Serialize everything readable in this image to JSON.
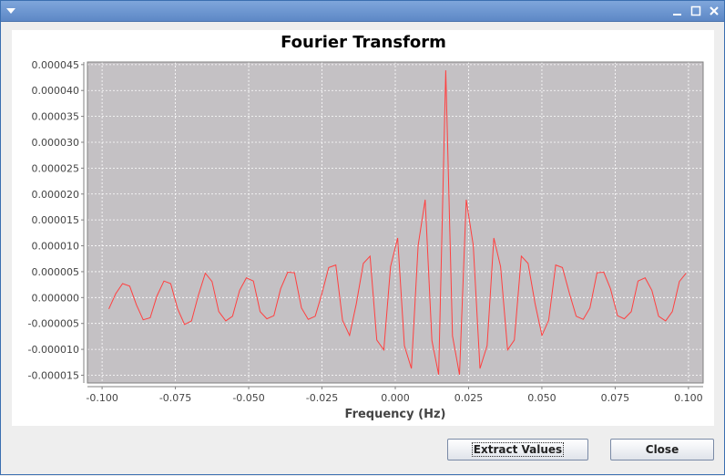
{
  "window": {
    "title": "",
    "icons": [
      "window-menu-icon",
      "minimize-icon",
      "maximize-icon",
      "close-icon"
    ]
  },
  "chart_data": {
    "type": "line",
    "title": "Fourier Transform",
    "xlabel": "Frequency (Hz)",
    "ylabel": "",
    "xlim": [
      -0.105,
      0.105
    ],
    "ylim": [
      -1.65e-05,
      4.55e-05
    ],
    "grid": true,
    "x_ticks": [
      -0.1,
      -0.075,
      -0.05,
      -0.025,
      0.0,
      0.025,
      0.05,
      0.075,
      0.1
    ],
    "x_tick_labels": [
      "-0.100",
      "-0.075",
      "-0.050",
      "-0.025",
      "0.000",
      "0.025",
      "0.050",
      "0.075",
      "0.100"
    ],
    "y_ticks": [
      -1.5e-05,
      -1e-05,
      -5e-06,
      0.0,
      5e-06,
      1e-05,
      1.5e-05,
      2e-05,
      2.5e-05,
      3e-05,
      3.5e-05,
      4e-05,
      4.5e-05
    ],
    "y_tick_labels": [
      "-0.000015",
      "-0.000010",
      "-0.000005",
      "0.000000",
      "0.000005",
      "0.000010",
      "0.000015",
      "0.000020",
      "0.000025",
      "0.000030",
      "0.000035",
      "0.000040",
      "0.000045"
    ],
    "colors": {
      "plot_background": "#c4c1c4",
      "line": "#ff4040",
      "grid": "#ffffff"
    },
    "series": [
      {
        "x": [
          -0.0977,
          -0.0953,
          -0.093,
          -0.0906,
          -0.0883,
          -0.086,
          -0.0836,
          -0.0813,
          -0.0789,
          -0.0766,
          -0.0742,
          -0.0719,
          -0.0695,
          -0.0672,
          -0.0648,
          -0.0625,
          -0.0602,
          -0.0578,
          -0.0555,
          -0.0531,
          -0.0508,
          -0.0484,
          -0.0461,
          -0.0438,
          -0.0414,
          -0.0391,
          -0.0367,
          -0.0344,
          -0.032,
          -0.0297,
          -0.0273,
          -0.025,
          -0.0227,
          -0.0203,
          -0.018,
          -0.0156,
          -0.0133,
          -0.0109,
          -0.0086,
          -0.0063,
          -0.0039,
          -0.0016,
          0.0008,
          0.0031,
          0.0055,
          0.0078,
          0.0102,
          0.0125,
          0.0148,
          0.0172,
          0.0195,
          0.0219,
          0.0242,
          0.0266,
          0.0289,
          0.0313,
          0.0336,
          0.0359,
          0.0383,
          0.0406,
          0.043,
          0.0453,
          0.0477,
          0.05,
          0.0523,
          0.0547,
          0.057,
          0.0594,
          0.0617,
          0.0641,
          0.0664,
          0.0688,
          0.0711,
          0.0734,
          0.0758,
          0.0781,
          0.0805,
          0.0828,
          0.0852,
          0.0875,
          0.0898,
          0.0922,
          0.0945,
          0.0969,
          0.0992
        ],
        "y": [
          -2.2e-06,
          8e-07,
          2.7e-06,
          2.2e-06,
          -1.4e-06,
          -4.3e-06,
          -3.9e-06,
          3e-07,
          3.2e-06,
          2.7e-06,
          -2.2e-06,
          -5.2e-06,
          -4.5e-06,
          4e-07,
          4.7e-06,
          3.1e-06,
          -2.7e-06,
          -4.5e-06,
          -3.6e-06,
          1.4e-06,
          3.8e-06,
          3.2e-06,
          -2.7e-06,
          -4.1e-06,
          -3.5e-06,
          1.7e-06,
          4.9e-06,
          4.8e-06,
          -2e-06,
          -4.2e-06,
          -3.6e-06,
          8e-07,
          5.8e-06,
          6.3e-06,
          -4.4e-06,
          -7.3e-06,
          -1.2e-06,
          6.6e-06,
          8e-06,
          -8.2e-06,
          -1.01e-05,
          6e-06,
          1.15e-05,
          -9.3e-06,
          -1.37e-05,
          1.01e-05,
          1.89e-05,
          -8.3e-06,
          -1.49e-05,
          4.39e-05,
          -7.4e-06,
          -1.49e-05,
          1.89e-05,
          1.01e-05,
          -1.37e-05,
          -9.3e-06,
          1.15e-05,
          6e-06,
          -1.01e-05,
          -8.2e-06,
          8e-06,
          6.6e-06,
          -1.2e-06,
          -7.3e-06,
          -4.4e-06,
          6.3e-06,
          5.8e-06,
          8e-07,
          -3.6e-06,
          -4.2e-06,
          -2e-06,
          4.8e-06,
          4.9e-06,
          1.7e-06,
          -3.5e-06,
          -4.1e-06,
          -2.7e-06,
          3.2e-06,
          3.8e-06,
          1.4e-06,
          -3.6e-06,
          -4.5e-06,
          -2.7e-06,
          3.1e-06,
          4.7e-06
        ]
      }
    ]
  },
  "buttons": {
    "extract_label": "Extract Values",
    "close_label": "Close"
  }
}
